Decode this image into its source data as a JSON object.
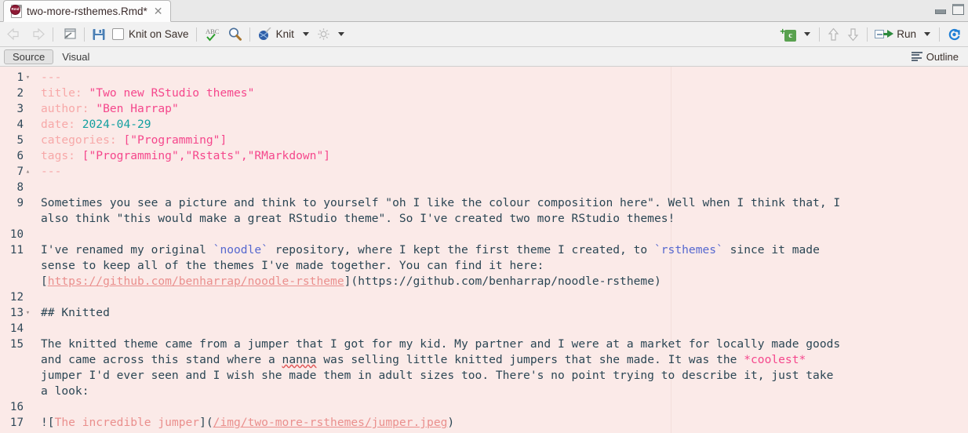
{
  "window": {
    "minimize_icon": "minimize-pane-icon",
    "maximize_icon": "maximize-pane-icon"
  },
  "tab": {
    "filename": "two-more-rsthemes.Rmd*",
    "file_icon": "rmd-file-icon",
    "badge_text": "Rmd",
    "close_glyph": "✕"
  },
  "toolbar": {
    "back_icon": "back-arrow-icon",
    "forward_icon": "forward-arrow-icon",
    "popout_icon": "show-in-new-window-icon",
    "save_icon": "save-icon",
    "knit_on_save_label": "Knit on Save",
    "knit_on_save_checked": false,
    "spellcheck_icon": "spellcheck-abc-icon",
    "find_icon": "find-replace-magnifier-icon",
    "knit_icon": "knit-yarn-icon",
    "knit_label": "Knit",
    "knit_caret": "knit-dropdown-caret",
    "gear_icon": "settings-gear-icon",
    "gear_caret": "settings-dropdown-caret",
    "insert_chunk_icon": "insert-chunk-icon",
    "insert_chunk_letter": "c",
    "insert_chunk_caret": "insert-chunk-caret",
    "prev_chunk_icon": "previous-chunk-arrow-icon",
    "next_chunk_icon": "next-chunk-arrow-icon",
    "run_icon": "run-icon",
    "run_label": "Run",
    "run_caret": "run-dropdown-caret",
    "rerun_icon": "rerun-previous-chunks-icon"
  },
  "modebar": {
    "source_label": "Source",
    "visual_label": "Visual",
    "active_tab": "Source",
    "outline_label": "Outline",
    "outline_icon": "outline-list-icon"
  },
  "colors": {
    "editor_background": "#fbeae8",
    "toolbar_background": "#f1f1f1",
    "body_text": "#2b4654",
    "yaml_key": "#f7a8a8",
    "yaml_string": "#f5478c",
    "yaml_number": "#14a0a0",
    "inline_code": "#5668cf",
    "markdown_link": "#ea8f8d",
    "markdown_emphasis": "#f5478c",
    "gutter_text": "#2f4858",
    "spellcheck_underline": "#e05a5a"
  },
  "editor": {
    "language": "R Markdown",
    "lines": [
      {
        "num": "1",
        "fold": "▾",
        "segments": [
          {
            "text": "---",
            "cls": "yd"
          }
        ]
      },
      {
        "num": "2",
        "fold": "",
        "segments": [
          {
            "text": "title:",
            "cls": "yk"
          },
          {
            "text": " ",
            "cls": ""
          },
          {
            "text": "\"Two new RStudio themes\"",
            "cls": "ys"
          }
        ]
      },
      {
        "num": "3",
        "fold": "",
        "segments": [
          {
            "text": "author:",
            "cls": "yk"
          },
          {
            "text": " ",
            "cls": ""
          },
          {
            "text": "\"Ben Harrap\"",
            "cls": "ys"
          }
        ]
      },
      {
        "num": "4",
        "fold": "",
        "segments": [
          {
            "text": "date:",
            "cls": "yk"
          },
          {
            "text": " ",
            "cls": ""
          },
          {
            "text": "2024-04-29",
            "cls": "yn"
          }
        ]
      },
      {
        "num": "5",
        "fold": "",
        "segments": [
          {
            "text": "categories:",
            "cls": "yk"
          },
          {
            "text": " ",
            "cls": ""
          },
          {
            "text": "[",
            "cls": "ys"
          },
          {
            "text": "\"Programming\"",
            "cls": "ys"
          },
          {
            "text": "]",
            "cls": "ys"
          }
        ]
      },
      {
        "num": "6",
        "fold": "",
        "segments": [
          {
            "text": "tags:",
            "cls": "yk"
          },
          {
            "text": " ",
            "cls": ""
          },
          {
            "text": "[\"Programming\",\"Rstats\",\"RMarkdown\"]",
            "cls": "ys"
          }
        ]
      },
      {
        "num": "7",
        "fold": "▴",
        "segments": [
          {
            "text": "---",
            "cls": "yd"
          }
        ]
      },
      {
        "num": "8",
        "fold": "",
        "segments": []
      },
      {
        "num": "9",
        "fold": "",
        "segments": [
          {
            "text": "Sometimes you see a picture and think to yourself \"oh I like the colour composition here\". Well when I think that, I",
            "cls": ""
          }
        ]
      },
      {
        "num": "",
        "fold": "",
        "segments": [
          {
            "text": "also think \"this would make a great RStudio theme\". So I've created two more RStudio themes!",
            "cls": ""
          }
        ]
      },
      {
        "num": "10",
        "fold": "",
        "segments": []
      },
      {
        "num": "11",
        "fold": "",
        "segments": [
          {
            "text": "I've renamed my original ",
            "cls": ""
          },
          {
            "text": "`noodle`",
            "cls": "inline-code"
          },
          {
            "text": " repository, where I kept the first theme I created, to ",
            "cls": ""
          },
          {
            "text": "`rsthemes`",
            "cls": "inline-code"
          },
          {
            "text": " since it made",
            "cls": ""
          }
        ]
      },
      {
        "num": "",
        "fold": "",
        "segments": [
          {
            "text": "sense to keep all of the themes I've made together. You can find it here:",
            "cls": ""
          }
        ]
      },
      {
        "num": "",
        "fold": "",
        "segments": [
          {
            "text": "[",
            "cls": ""
          },
          {
            "text": "https://github.com/benharrap/noodle-rstheme",
            "cls": "md-link"
          },
          {
            "text": "](",
            "cls": ""
          },
          {
            "text": "https://github.com/benharrap/noodle-rstheme",
            "cls": ""
          },
          {
            "text": ")",
            "cls": ""
          }
        ]
      },
      {
        "num": "12",
        "fold": "",
        "segments": []
      },
      {
        "num": "13",
        "fold": "▾",
        "segments": [
          {
            "text": "## Knitted",
            "cls": ""
          }
        ]
      },
      {
        "num": "14",
        "fold": "",
        "segments": []
      },
      {
        "num": "15",
        "fold": "",
        "segments": [
          {
            "text": "The knitted theme came from a jumper that I got for my kid. My partner and I were at a market for locally made goods",
            "cls": ""
          }
        ]
      },
      {
        "num": "",
        "fold": "",
        "segments": [
          {
            "text": "and came across this stand where a ",
            "cls": ""
          },
          {
            "text": "nanna",
            "cls": "spell"
          },
          {
            "text": " was selling little knitted jumpers that she made. It was the ",
            "cls": ""
          },
          {
            "text": "*coolest*",
            "cls": "md-em"
          }
        ]
      },
      {
        "num": "",
        "fold": "",
        "segments": [
          {
            "text": "jumper I'd ever seen and I wish she made them in adult sizes too. There's no point trying to describe it, just take",
            "cls": ""
          }
        ]
      },
      {
        "num": "",
        "fold": "",
        "segments": [
          {
            "text": "a look:",
            "cls": ""
          }
        ]
      },
      {
        "num": "16",
        "fold": "",
        "segments": []
      },
      {
        "num": "17",
        "fold": "",
        "segments": [
          {
            "text": "![",
            "cls": ""
          },
          {
            "text": "The incredible jumper",
            "cls": "md-alt"
          },
          {
            "text": "](",
            "cls": ""
          },
          {
            "text": "/img/two-more-rsthemes/jumper.jpeg",
            "cls": "md-link"
          },
          {
            "text": ")",
            "cls": ""
          }
        ]
      }
    ]
  }
}
